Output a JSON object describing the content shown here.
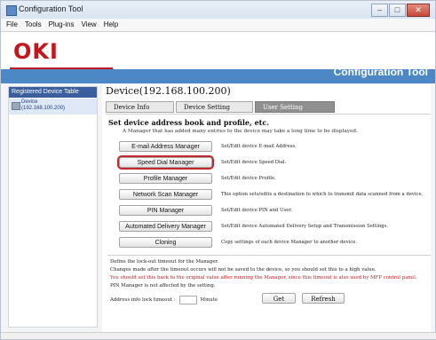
{
  "window": {
    "title": "Configuration Tool",
    "buttons": [
      "–",
      "□",
      "✕"
    ]
  },
  "menu": [
    "File",
    "Tools",
    "Plug-ins",
    "View",
    "Help"
  ],
  "banner": {
    "logo": "OKI",
    "title": "Configuration Tool"
  },
  "sidebar": {
    "header": "Registered Device Table",
    "device": {
      "name": "Device",
      "ip": "(192.168.100.200)"
    }
  },
  "device_header": "Device(192.168.100.200)",
  "tabs": [
    "Device Info",
    "Device Setting",
    "User Setting"
  ],
  "section": {
    "title": "Set device address book and profile, etc.",
    "subtitle": "A Manager that has added many entries to the device may take a long time to be displayed."
  },
  "managers": [
    {
      "button": "E-mail Address Manager",
      "desc": "Set/Edit device E-mail Address."
    },
    {
      "button": "Speed Dial Manager",
      "desc": "Set/Edit device Speed Dial."
    },
    {
      "button": "Profile Manager",
      "desc": "Set/Edit device Profile."
    },
    {
      "button": "Network Scan Manager",
      "desc": "This option sets/edits a destination to which to transmit data scanned from a device."
    },
    {
      "button": "PIN Manager",
      "desc": "Set/Edit device PIN and User."
    },
    {
      "button": "Automated Delivery Manager",
      "desc": "Set/Edit device Automated Delivery Setup and Transmission Settings."
    },
    {
      "button": "Cloning",
      "desc": "Copy settings of each device Manager to another device."
    }
  ],
  "lockout": {
    "line1": "Define the lock-out timeout for the Manager.",
    "line2": "Changes made after the timeout occurs will not be saved to the device, so you should set this to a high value.",
    "line3": "You should set this back to the original value after running the Manager, since this timeout is also used by MFP control panel.",
    "line4": "PIN Manager is not affected by the setting.",
    "timeout_label": "Address info lock timeout :",
    "timeout_value": "",
    "unit": "Minute",
    "get": "Get",
    "refresh": "Refresh"
  },
  "colors": {
    "brand_red": "#c4171d",
    "banner_blue": "#4b88c5",
    "highlight": "#c5272e"
  }
}
